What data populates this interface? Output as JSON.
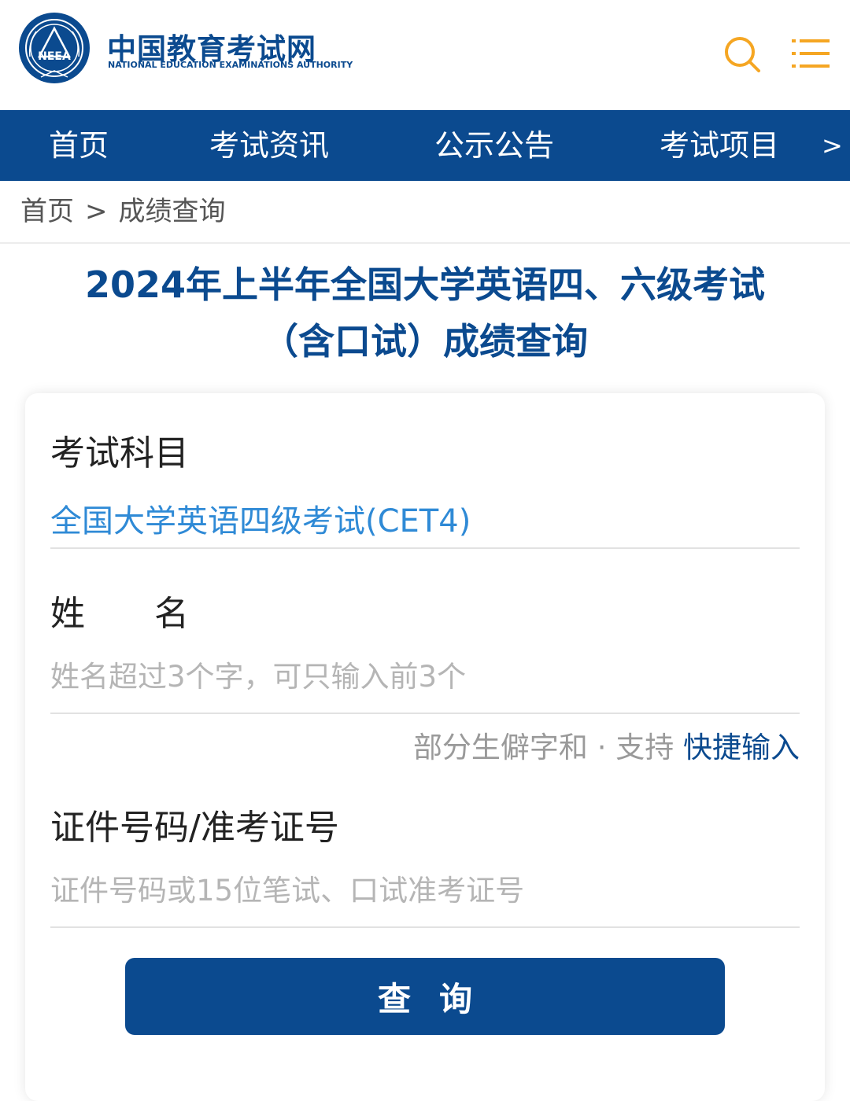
{
  "header": {
    "logo_text_cn": "中国教育考试网",
    "logo_text_en": "NATIONAL EDUCATION EXAMINATIONS AUTHORITY",
    "emblem_text": "NEEA",
    "icons": {
      "search": "search-icon",
      "menu": "menu-icon"
    },
    "colors": {
      "brand": "#0b4a8f",
      "accent": "#f5a623"
    }
  },
  "nav": {
    "items": [
      {
        "label": "首页"
      },
      {
        "label": "考试资讯"
      },
      {
        "label": "公示公告"
      },
      {
        "label": "考试项目"
      }
    ],
    "more": ">"
  },
  "breadcrumb": {
    "home": "首页",
    "separator": ">",
    "current": "成绩查询"
  },
  "page": {
    "title_line1": "2024年上半年全国大学英语四、六级考试",
    "title_line2": "（含口试）成绩查询"
  },
  "form": {
    "subject": {
      "label": "考试科目",
      "value": "全国大学英语四级考试(CET4)"
    },
    "name": {
      "label": "姓　　名",
      "placeholder": "姓名超过3个字，可只输入前3个",
      "hint": "部分生僻字和 · 支持",
      "hint_link": "快捷输入"
    },
    "id": {
      "label": "证件号码/准考证号",
      "placeholder": "证件号码或15位笔试、口试准考证号"
    },
    "submit_label": "查询"
  }
}
